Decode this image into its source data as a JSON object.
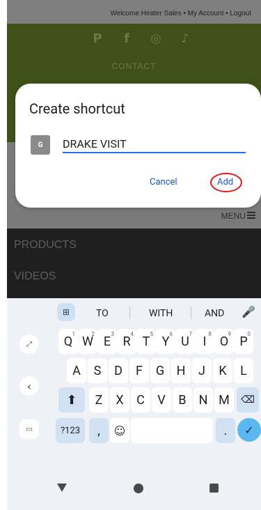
{
  "site": {
    "topbar_text": "Welcome Heater Sales • My Account • Logout",
    "social_icons": [
      "pinterest-icon",
      "facebook-icon",
      "instagram-icon",
      "tiktok-icon"
    ],
    "contact_label": "CONTACT",
    "menu_label": "MENU",
    "nav_products": "PRODUCTS",
    "nav_videos": "VIDEOS",
    "colors": {
      "green_band": "#3f5118",
      "dark_band": "#1f1f1f"
    }
  },
  "dialog": {
    "title": "Create shortcut",
    "app_icon_letter": "G",
    "name_value": "DRAKE VISIT",
    "cancel_label": "Cancel",
    "add_label": "Add",
    "accent_color": "#1a73e8",
    "highlight_color": "#e01818"
  },
  "keyboard": {
    "suggestions": [
      "TO",
      "WITH",
      "AND"
    ],
    "row1": [
      {
        "k": "Q",
        "n": "1"
      },
      {
        "k": "W",
        "n": "2"
      },
      {
        "k": "E",
        "n": "3"
      },
      {
        "k": "R",
        "n": "4"
      },
      {
        "k": "T",
        "n": "5"
      },
      {
        "k": "Y",
        "n": "6"
      },
      {
        "k": "U",
        "n": "7"
      },
      {
        "k": "I",
        "n": "8"
      },
      {
        "k": "O",
        "n": "9"
      },
      {
        "k": "P",
        "n": "0"
      }
    ],
    "row2": [
      "A",
      "S",
      "D",
      "F",
      "G",
      "H",
      "J",
      "K",
      "L"
    ],
    "row3": [
      "Z",
      "X",
      "C",
      "V",
      "B",
      "N",
      "M"
    ],
    "symbols_label": "?123",
    "comma_label": ",",
    "period_label": "."
  }
}
